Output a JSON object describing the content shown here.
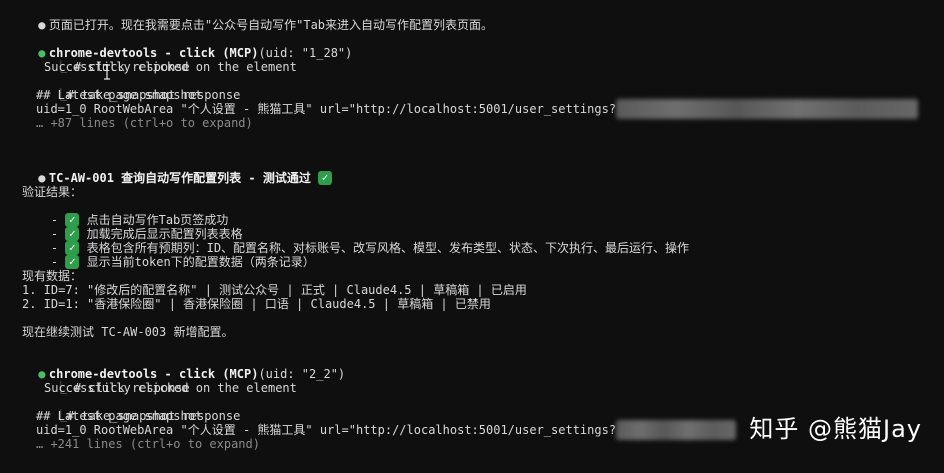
{
  "intro": "页面已打开。现在我需要点击\"公众号自动写作\"Tab来进入自动写作配置列表页面。",
  "call1": {
    "tool": "chrome-devtools",
    "sep": " - ",
    "action": "click (MCP)",
    "args": "(uid: \"1_28\")",
    "resp_header": "# click response",
    "resp_text": "Successfully clicked on the element",
    "snap_header": "# take_snapshot response",
    "snap_title": "## Latest page snapshot",
    "snap_line": "uid=1_0 RootWebArea \"个人设置 - 熊猫工具\" url=\"http://localhost:5001/user_settings?",
    "expand": "… +87 lines (ctrl+o to expand)"
  },
  "test": {
    "title": "TC-AW-001 查询自动写作配置列表 - 测试通过",
    "results_label": "验证结果：",
    "results": [
      "点击自动写作Tab页签成功",
      "加载完成后显示配置列表表格",
      "表格包含所有预期列：ID、配置名称、对标账号、改写风格、模型、发布类型、状态、下次执行、最后运行、操作",
      "显示当前token下的配置数据（两条记录）"
    ],
    "data_label": "现有数据：",
    "rows": [
      "1. ID=7: \"修改后的配置名称\" | 测试公众号 | 正式 | Claude4.5 | 草稿箱 | 已启用",
      "2. ID=1: \"香港保险圈\" | 香港保险圈 | 口语 | Claude4.5 | 草稿箱 | 已禁用"
    ],
    "next": "现在继续测试 TC-AW-003 新增配置。"
  },
  "call2": {
    "tool": "chrome-devtools",
    "sep": " - ",
    "action": "click (MCP)",
    "args": "(uid: \"2_2\")",
    "resp_header": "# click response",
    "resp_text": "Successfully clicked on the element",
    "snap_header": "# take_snapshot response",
    "snap_title": "## Latest page snapshot",
    "snap_line": "uid=1_0 RootWebArea \"个人设置 - 熊猫工具\" url=\"http://localhost:5001/user_settings?",
    "expand": "… +241 lines (ctrl+o to expand)"
  },
  "watermark": "知乎 @熊猫Jay",
  "symbols": {
    "bullet": "●",
    "tree_first": "⎿",
    "tree_second": "⎿",
    "dash": "- ",
    "check": "✓"
  },
  "colors": {
    "background": "#0f0f0f",
    "text": "#d8d8d8",
    "success_bullet": "#4cbc6a",
    "check_badge": "#2f9e4a",
    "dim": "#8a8a8a"
  }
}
